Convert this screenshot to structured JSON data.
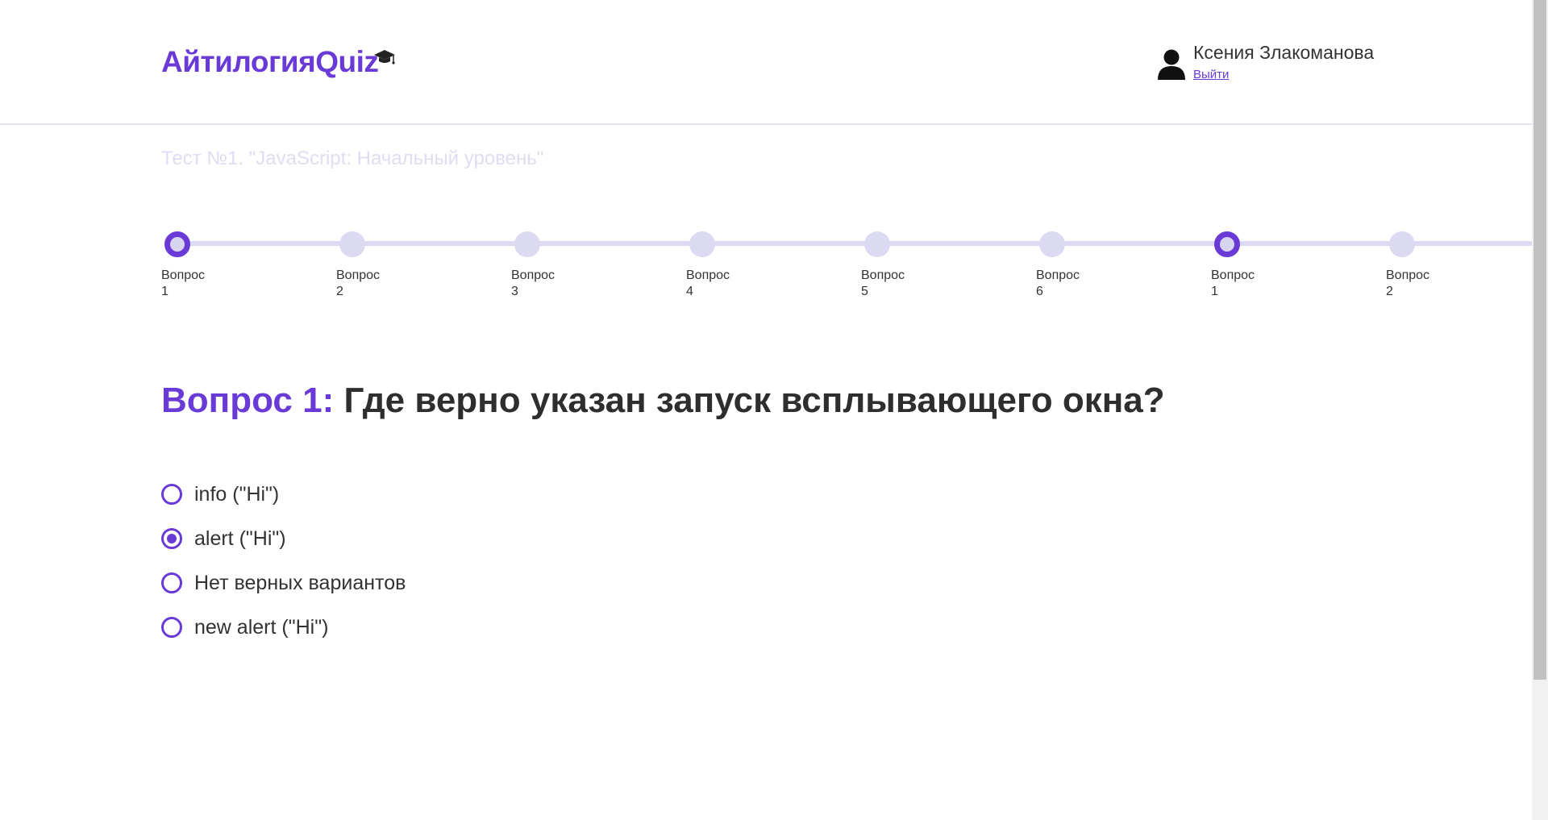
{
  "header": {
    "logo_text": "АйтилогияQuiz",
    "logo_icon": "graduation-cap-icon",
    "user_icon": "user-icon",
    "user_name": "Ксения Злакоманова",
    "logout_label": "Выйти"
  },
  "test": {
    "title": "Тест №1. \"JavaScript: Начальный уровень\""
  },
  "stepper": {
    "steps": [
      {
        "label": "Вопрос",
        "number": "1",
        "active": true
      },
      {
        "label": "Вопрос",
        "number": "2",
        "active": false
      },
      {
        "label": "Вопрос",
        "number": "3",
        "active": false
      },
      {
        "label": "Вопрос",
        "number": "4",
        "active": false
      },
      {
        "label": "Вопрос",
        "number": "5",
        "active": false
      },
      {
        "label": "Вопрос",
        "number": "6",
        "active": false
      },
      {
        "label": "Вопрос",
        "number": "1",
        "active": true
      },
      {
        "label": "Вопрос",
        "number": "2",
        "active": false
      }
    ]
  },
  "question": {
    "prefix": "Вопрос 1:",
    "text": "Где верно указан запуск всплывающего окна?",
    "answers": [
      {
        "label": "info (\"Hi\")",
        "checked": false
      },
      {
        "label": "alert (\"Hi\")",
        "checked": true
      },
      {
        "label": "Нет верных вариантов",
        "checked": false
      },
      {
        "label": "new alert (\"Hi\")",
        "checked": false
      }
    ]
  },
  "colors": {
    "accent": "#6a3ad6",
    "step_inactive": "#dcdaf2",
    "title_faded": "#e0ddf2",
    "text": "#333333"
  }
}
